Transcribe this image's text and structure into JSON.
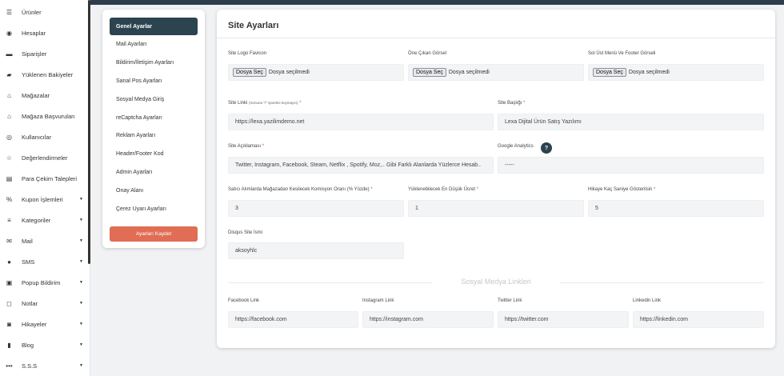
{
  "sidebar": {
    "items": [
      {
        "label": "Ürünler",
        "icon": "list-icon",
        "glyph": "☰",
        "caret": false
      },
      {
        "label": "Hesaplar",
        "icon": "user-circle-icon",
        "glyph": "◉",
        "caret": false
      },
      {
        "label": "Siparişler",
        "icon": "credit-card-icon",
        "glyph": "▬",
        "caret": false
      },
      {
        "label": "Yüklenen Bakiyeler",
        "icon": "wallet-icon",
        "glyph": "▰",
        "caret": false
      },
      {
        "label": "Mağazalar",
        "icon": "store-icon",
        "glyph": "⌂",
        "caret": false
      },
      {
        "label": "Mağaza Başvuruları",
        "icon": "store-application-icon",
        "glyph": "⌂",
        "caret": false
      },
      {
        "label": "Kullanıcılar",
        "icon": "users-icon",
        "glyph": "◎",
        "caret": false
      },
      {
        "label": "Değerlendirmeler",
        "icon": "star-icon",
        "glyph": "☆",
        "caret": false
      },
      {
        "label": "Para Çekim Talepleri",
        "icon": "money-icon",
        "glyph": "▤",
        "caret": false
      },
      {
        "label": "Kupon İşlemleri",
        "icon": "percent-icon",
        "glyph": "%",
        "caret": true
      },
      {
        "label": "Kategoriler",
        "icon": "category-icon",
        "glyph": "≡",
        "caret": true
      },
      {
        "label": "Mail",
        "icon": "mail-icon",
        "glyph": "✉",
        "caret": true
      },
      {
        "label": "SMS",
        "icon": "chat-icon",
        "glyph": "●",
        "caret": true
      },
      {
        "label": "Popup Bildirim",
        "icon": "popup-icon",
        "glyph": "▣",
        "caret": true
      },
      {
        "label": "Notlar",
        "icon": "note-icon",
        "glyph": "◻",
        "caret": true
      },
      {
        "label": "Hikayeler",
        "icon": "camera-icon",
        "glyph": "◙",
        "caret": true
      },
      {
        "label": "Blog",
        "icon": "blog-icon",
        "glyph": "▮",
        "caret": true
      },
      {
        "label": "S.S.S",
        "icon": "faq-icon",
        "glyph": "•••",
        "caret": true
      }
    ]
  },
  "settings_menu": {
    "items": [
      {
        "label": "Genel Ayarlar",
        "active": true
      },
      {
        "label": "Mail Ayarları",
        "active": false
      },
      {
        "label": "Bildirim/İletişim Ayarları",
        "active": false
      },
      {
        "label": "Sanal Pos Ayarları",
        "active": false
      },
      {
        "label": "Sosyal Medya Giriş",
        "active": false
      },
      {
        "label": "reCaptcha Ayarları",
        "active": false
      },
      {
        "label": "Reklam Ayarları",
        "active": false
      },
      {
        "label": "Header/Footer Kod",
        "active": false
      },
      {
        "label": "Admin Ayarları",
        "active": false
      },
      {
        "label": "Onay Alanı",
        "active": false
      },
      {
        "label": "Çerez Uyarı Ayarları",
        "active": false
      }
    ],
    "save_label": "Ayarları Kaydet"
  },
  "main": {
    "title": "Site Ayarları",
    "logo": {
      "label": "Site Logo Favicon",
      "button": "Dosya Seç",
      "status": "Dosya seçilmedi"
    },
    "featured_image": {
      "label": "Öne Çıkan Görsel",
      "button": "Dosya Seç",
      "status": "Dosya seçilmedi"
    },
    "menu_footer_image": {
      "label": "Sol Üst Menü Ve Footer Görseli",
      "button": "Dosya Seç",
      "status": "Dosya seçilmedi"
    },
    "site_link": {
      "label": "Site Linki",
      "hint": "(Sonuna \"/\" işaretini koymayın)",
      "value": "https://lexa.yazilimdemo.net"
    },
    "site_title": {
      "label": "Site Başlığı",
      "value": "Lexa Dijital Ürün Satış Yazılımı"
    },
    "site_description": {
      "label": "Site Açıklaması",
      "value": "Twitter, Instagram, Facebook, Steam, Netflix , Spotify, Moz,.. Gibi Farklı Alanlarda Yüzlerce Hesab.."
    },
    "google_analytics": {
      "label": "Google Analytics",
      "help": "?",
      "value": "-----"
    },
    "commission": {
      "label": "Satıcı Alımlarda Mağazadan Kesilecek Komisyon Oranı (% Yüzde)",
      "value": "3"
    },
    "min_payment": {
      "label": "Yüklenebilecek En Düşük Ücret",
      "value": "1"
    },
    "story_seconds": {
      "label": "Hikaye Kaç Saniye Gösterilsin",
      "value": "5"
    },
    "disqus": {
      "label": "Disqus Site İsmi",
      "value": "aksoyhlc"
    },
    "social_title": "Sosyal Medya Linkleri",
    "facebook": {
      "label": "Facebook Link",
      "value": "https://facebook.com"
    },
    "instagram": {
      "label": "Instagram Link",
      "value": "https://instagram.com"
    },
    "twitter": {
      "label": "Twitter Link",
      "value": "https://twitter.com"
    },
    "linkedin": {
      "label": "Linkedin Link",
      "value": "https://linkedin.com"
    },
    "required_mark": "*"
  }
}
